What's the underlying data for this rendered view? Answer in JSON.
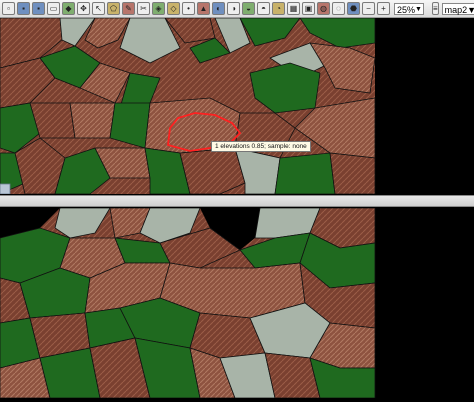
{
  "toolbar": {
    "zoom_value": "25%",
    "layer_value": "map2",
    "icons": [
      "new-icon",
      "open-icon",
      "save-icon",
      "print-icon",
      "layer-icon",
      "pan-icon",
      "select-icon",
      "polygon-icon",
      "edit-icon",
      "cut-icon",
      "merge-icon",
      "split-icon",
      "vertex-icon",
      "measure-icon",
      "tool-icon",
      "tool-icon",
      "tool-icon",
      "tool-icon",
      "tool-icon",
      "grid-icon",
      "tool-icon",
      "tool-icon",
      "tool-icon",
      "fill-icon",
      "zoom-out-icon",
      "zoom-in-icon"
    ]
  },
  "top_view": {
    "tooltip": "1 elevations 0.85; sample: none"
  },
  "colors": {
    "brown": "#7a4030",
    "brown_light": "#9a5c48",
    "green": "#1f6a1f",
    "grey": "#a8b4a8",
    "border": "#111111",
    "highlight": "#ff2020"
  }
}
